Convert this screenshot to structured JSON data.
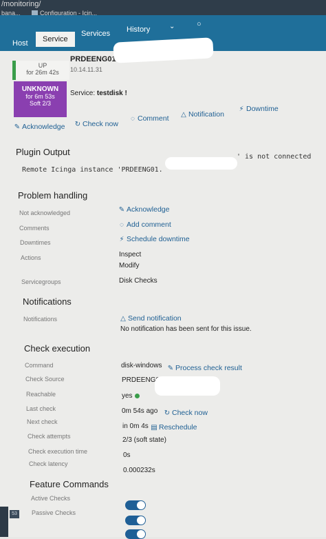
{
  "browser": {
    "url": "/monitoring/",
    "tabs": [
      {
        "label": "bana..."
      },
      {
        "label": "Configuration - Icin..."
      }
    ]
  },
  "nav": {
    "tabs": [
      {
        "label": "Host"
      },
      {
        "label": "Service"
      },
      {
        "label": "Services"
      },
      {
        "label": "History"
      }
    ]
  },
  "host": {
    "state": "UP",
    "duration": "for 26m 42s",
    "name": "PRDEENG01",
    "ip": "10.14.11.31"
  },
  "service": {
    "state": "UNKNOWN",
    "duration": "for 6m 53s",
    "soft": "Soft 2/3",
    "label": "Service:",
    "name": "testdisk",
    "flag": "!"
  },
  "actions": {
    "acknowledge": "Acknowledge",
    "check_now": "Check now",
    "comment": "Comment",
    "notification": "Notification",
    "downtime": "Downtime"
  },
  "plugin_output": {
    "title": "Plugin Output",
    "text_start": "Remote Icinga instance 'PRDEENG01.",
    "text_end": "' is not connected"
  },
  "problem_handling": {
    "title": "Problem handling",
    "not_acknowledged": "Not acknowledged",
    "acknowledge_link": "Acknowledge",
    "comments": "Comments",
    "add_comment": "Add comment",
    "downtimes": "Downtimes",
    "schedule_downtime": "Schedule downtime",
    "actions": "Actions",
    "inspect": "Inspect",
    "modify": "Modify",
    "servicegroups": "Servicegroups",
    "servicegroups_value": "Disk Checks"
  },
  "notifications": {
    "title": "Notifications",
    "label": "Notifications",
    "send": "Send notification",
    "none_sent": "No notification has been sent for this issue."
  },
  "check_execution": {
    "title": "Check execution",
    "command_label": "Command",
    "command_value": "disk-windows",
    "process_result": "Process check result",
    "check_source_label": "Check Source",
    "check_source_value": "PRDEENG01",
    "reachable_label": "Reachable",
    "reachable_value": "yes",
    "last_check_label": "Last check",
    "last_check_value": "0m 54s ago",
    "check_now": "Check now",
    "next_check_label": "Next check",
    "next_check_value": "in 0m 4s",
    "reschedule": "Reschedule",
    "attempts_label": "Check attempts",
    "attempts_value": "2/3 (soft state)",
    "exec_time_label": "Check execution time",
    "exec_time_value": "0s",
    "latency_label": "Check latency",
    "latency_value": "0.000232s"
  },
  "feature_commands": {
    "title": "Feature Commands",
    "active_checks": "Active Checks",
    "passive_checks": "Passive Checks"
  },
  "corner": {
    "badge": "53"
  },
  "colors": {
    "nav": "#1f6f9a",
    "up": "#3a9d4a",
    "unknown": "#8a3fb0",
    "link": "#1e5f93"
  }
}
